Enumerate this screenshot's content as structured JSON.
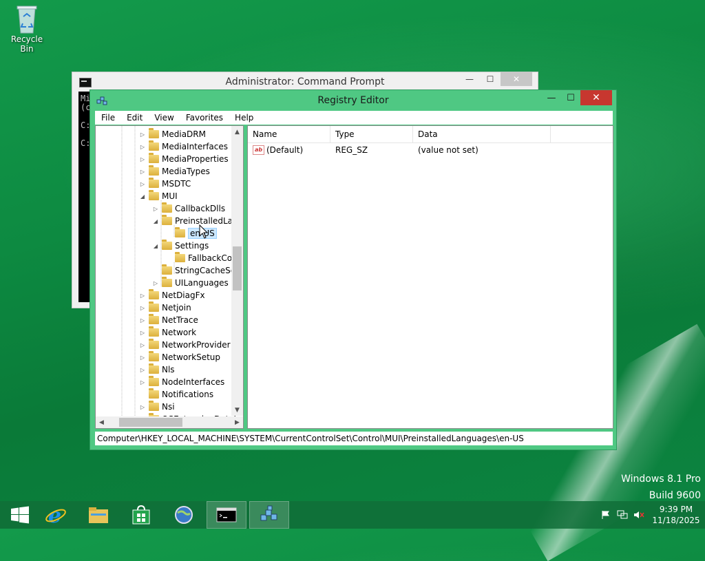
{
  "desktop": {
    "recycle_bin_label": "Recycle Bin",
    "watermark_line1": "Windows 8.1 Pro",
    "watermark_line2": "Build 9600"
  },
  "cmd_window": {
    "title": "Administrator: Command Prompt",
    "console_lines": [
      "Mi",
      "(c",
      "",
      "C:",
      "",
      "C:"
    ],
    "minimize": "—",
    "maximize": "☐",
    "close": "✕"
  },
  "regedit": {
    "title": "Registry Editor",
    "minimize": "—",
    "maximize": "☐",
    "close": "✕",
    "menu": [
      "File",
      "Edit",
      "View",
      "Favorites",
      "Help"
    ],
    "tree": [
      {
        "label": "MediaDRM",
        "level": 0,
        "expander": "▷"
      },
      {
        "label": "MediaInterfaces",
        "level": 0,
        "expander": "▷"
      },
      {
        "label": "MediaProperties",
        "level": 0,
        "expander": "▷"
      },
      {
        "label": "MediaTypes",
        "level": 0,
        "expander": "▷"
      },
      {
        "label": "MSDTC",
        "level": 0,
        "expander": "▷"
      },
      {
        "label": "MUI",
        "level": 0,
        "expander": "◢"
      },
      {
        "label": "CallbackDlls",
        "level": 1,
        "expander": "▷"
      },
      {
        "label": "PreinstalledLa",
        "level": 1,
        "expander": "◢"
      },
      {
        "label": "en-US",
        "level": 2,
        "expander": "",
        "selected": true
      },
      {
        "label": "Settings",
        "level": 1,
        "expander": "◢"
      },
      {
        "label": "FallbackCo",
        "level": 2,
        "expander": ""
      },
      {
        "label": "StringCacheSe",
        "level": 1,
        "expander": ""
      },
      {
        "label": "UILanguages",
        "level": 1,
        "expander": "▷"
      },
      {
        "label": "NetDiagFx",
        "level": 0,
        "expander": "▷"
      },
      {
        "label": "Netjoin",
        "level": 0,
        "expander": "▷"
      },
      {
        "label": "NetTrace",
        "level": 0,
        "expander": "▷"
      },
      {
        "label": "Network",
        "level": 0,
        "expander": "▷"
      },
      {
        "label": "NetworkProvider",
        "level": 0,
        "expander": "▷"
      },
      {
        "label": "NetworkSetup",
        "level": 0,
        "expander": "▷"
      },
      {
        "label": "Nls",
        "level": 0,
        "expander": "▷"
      },
      {
        "label": "NodeInterfaces",
        "level": 0,
        "expander": "▷"
      },
      {
        "label": "Notifications",
        "level": 0,
        "expander": ""
      },
      {
        "label": "Nsi",
        "level": 0,
        "expander": "▷"
      },
      {
        "label": "OSExtensionDatab",
        "level": 0,
        "expander": "▷"
      }
    ],
    "columns": [
      "Name",
      "Type",
      "Data"
    ],
    "rows": [
      {
        "name": "(Default)",
        "type": "REG_SZ",
        "data": "(value not set)",
        "icon": "string-value-icon"
      }
    ],
    "value_icon_text": "ab",
    "status_path": "Computer\\HKEY_LOCAL_MACHINE\\SYSTEM\\CurrentControlSet\\Control\\MUI\\PreinstalledLanguages\\en-US",
    "scroll_up": "▲",
    "scroll_down": "▼",
    "scroll_left": "◀",
    "scroll_right": "▶"
  },
  "taskbar": {
    "items": [
      {
        "name": "start-button",
        "icon": "windows-logo-icon"
      },
      {
        "name": "internet-explorer",
        "icon": "ie-icon"
      },
      {
        "name": "file-explorer",
        "icon": "folder-icon"
      },
      {
        "name": "store",
        "icon": "store-icon"
      },
      {
        "name": "globe-app",
        "icon": "globe-icon"
      },
      {
        "name": "command-prompt",
        "icon": "cmd-icon",
        "active": true
      },
      {
        "name": "registry-editor",
        "icon": "regedit-icon",
        "active": true
      }
    ],
    "clock_time": "9:39 PM",
    "clock_date": "11/18/2025"
  }
}
